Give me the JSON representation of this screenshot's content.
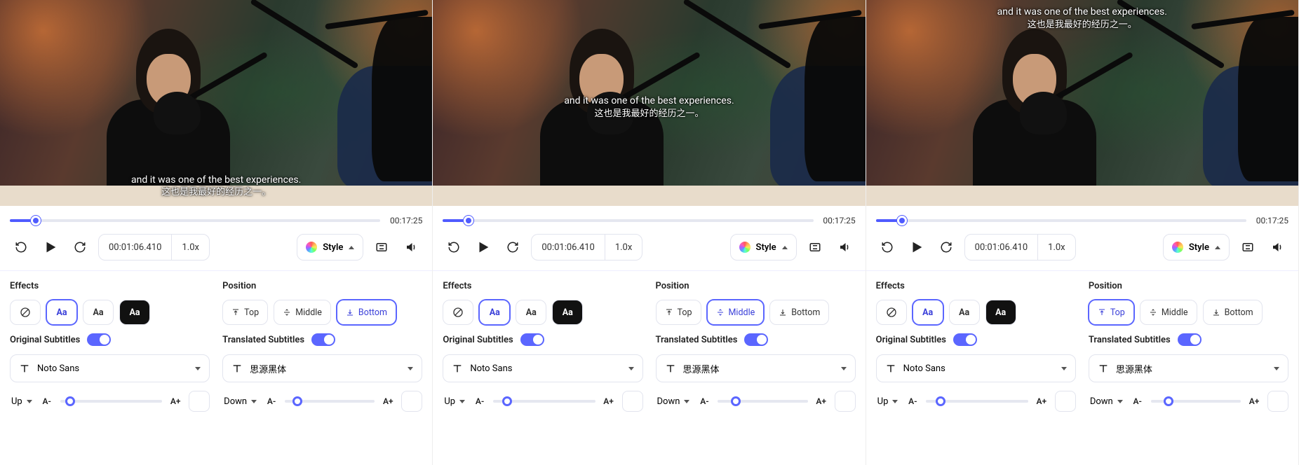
{
  "panels": [
    {
      "subtitle_position": "bottom",
      "subtitle_en": "and it was one of the best experiences.",
      "subtitle_zh": "这也是我最好的经历之一。",
      "seek": {
        "progress_pct": 7,
        "total": "00:17:25"
      },
      "transport": {
        "current_time": "00:01:06.410",
        "speed": "1.0x",
        "style_label": "Style"
      },
      "effects_label": "Effects",
      "position_label": "Position",
      "positions": {
        "top": "Top",
        "middle": "Middle",
        "bottom": "Bottom",
        "active": "bottom"
      },
      "original_label": "Original Subtitles",
      "translated_label": "Translated Subtitles",
      "original_font": "Noto Sans",
      "translated_font": "思源黑体",
      "original_dir": "Up",
      "translated_dir": "Down",
      "size_minus": "A-",
      "size_plus": "A+",
      "orig_slider_pct": 10,
      "trans_slider_pct": 14
    },
    {
      "subtitle_position": "middle",
      "subtitle_en": "and it was one of the best experiences.",
      "subtitle_zh": "这也是我最好的经历之一。",
      "seek": {
        "progress_pct": 7,
        "total": "00:17:25"
      },
      "transport": {
        "current_time": "00:01:06.410",
        "speed": "1.0x",
        "style_label": "Style"
      },
      "effects_label": "Effects",
      "position_label": "Position",
      "positions": {
        "top": "Top",
        "middle": "Middle",
        "bottom": "Bottom",
        "active": "middle"
      },
      "original_label": "Original Subtitles",
      "translated_label": "Translated Subtitles",
      "original_font": "Noto Sans",
      "translated_font": "思源黑体",
      "original_dir": "Up",
      "translated_dir": "Down",
      "size_minus": "A-",
      "size_plus": "A+",
      "orig_slider_pct": 14,
      "trans_slider_pct": 20
    },
    {
      "subtitle_position": "top",
      "subtitle_en": "and it was one of the best experiences.",
      "subtitle_zh": "这也是我最好的经历之一。",
      "seek": {
        "progress_pct": 7,
        "total": "00:17:25"
      },
      "transport": {
        "current_time": "00:01:06.410",
        "speed": "1.0x",
        "style_label": "Style"
      },
      "effects_label": "Effects",
      "position_label": "Position",
      "positions": {
        "top": "Top",
        "middle": "Middle",
        "bottom": "Bottom",
        "active": "top"
      },
      "original_label": "Original Subtitles",
      "translated_label": "Translated Subtitles",
      "original_font": "Noto Sans",
      "translated_font": "思源黑体",
      "original_dir": "Up",
      "translated_dir": "Down",
      "size_minus": "A-",
      "size_plus": "A+",
      "orig_slider_pct": 14,
      "trans_slider_pct": 20
    }
  ]
}
